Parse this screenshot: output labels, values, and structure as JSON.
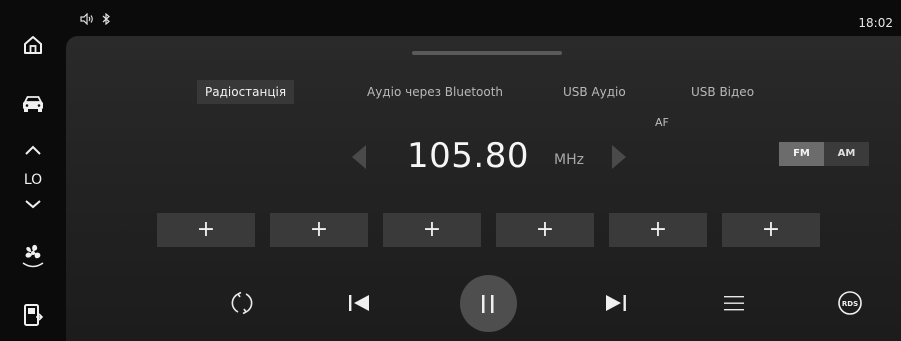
{
  "status_bar": {
    "time": "18:02",
    "icons": [
      "volume-icon",
      "bluetooth-icon"
    ]
  },
  "sidebar": {
    "items": [
      {
        "name": "home",
        "icon": "home-icon"
      },
      {
        "name": "car",
        "icon": "car-icon"
      },
      {
        "name": "climate-temp",
        "label": "LO"
      },
      {
        "name": "fan",
        "icon": "fan-icon"
      },
      {
        "name": "phone",
        "icon": "phone-icon"
      }
    ]
  },
  "tabs": [
    {
      "label": "Радіостанція",
      "active": true
    },
    {
      "label": "Аудіо через Bluetooth",
      "active": false
    },
    {
      "label": "USB Аудіо",
      "active": false
    },
    {
      "label": "USB Відео",
      "active": false
    }
  ],
  "tuner": {
    "af_label": "AF",
    "frequency": "105.80",
    "unit": "MHz"
  },
  "band": {
    "fm_label": "FM",
    "am_label": "AM",
    "selected": "FM"
  },
  "presets": [
    "+",
    "+",
    "+",
    "+",
    "+",
    "+"
  ],
  "controls": [
    "scan-icon",
    "previous-icon",
    "pause-icon",
    "next-icon",
    "list-icon",
    "rds-icon"
  ],
  "rds_label": "RDS",
  "colors": {
    "panel": "#262626",
    "preset": "#3a3a3a",
    "accent_band": "#6c6c6c"
  }
}
